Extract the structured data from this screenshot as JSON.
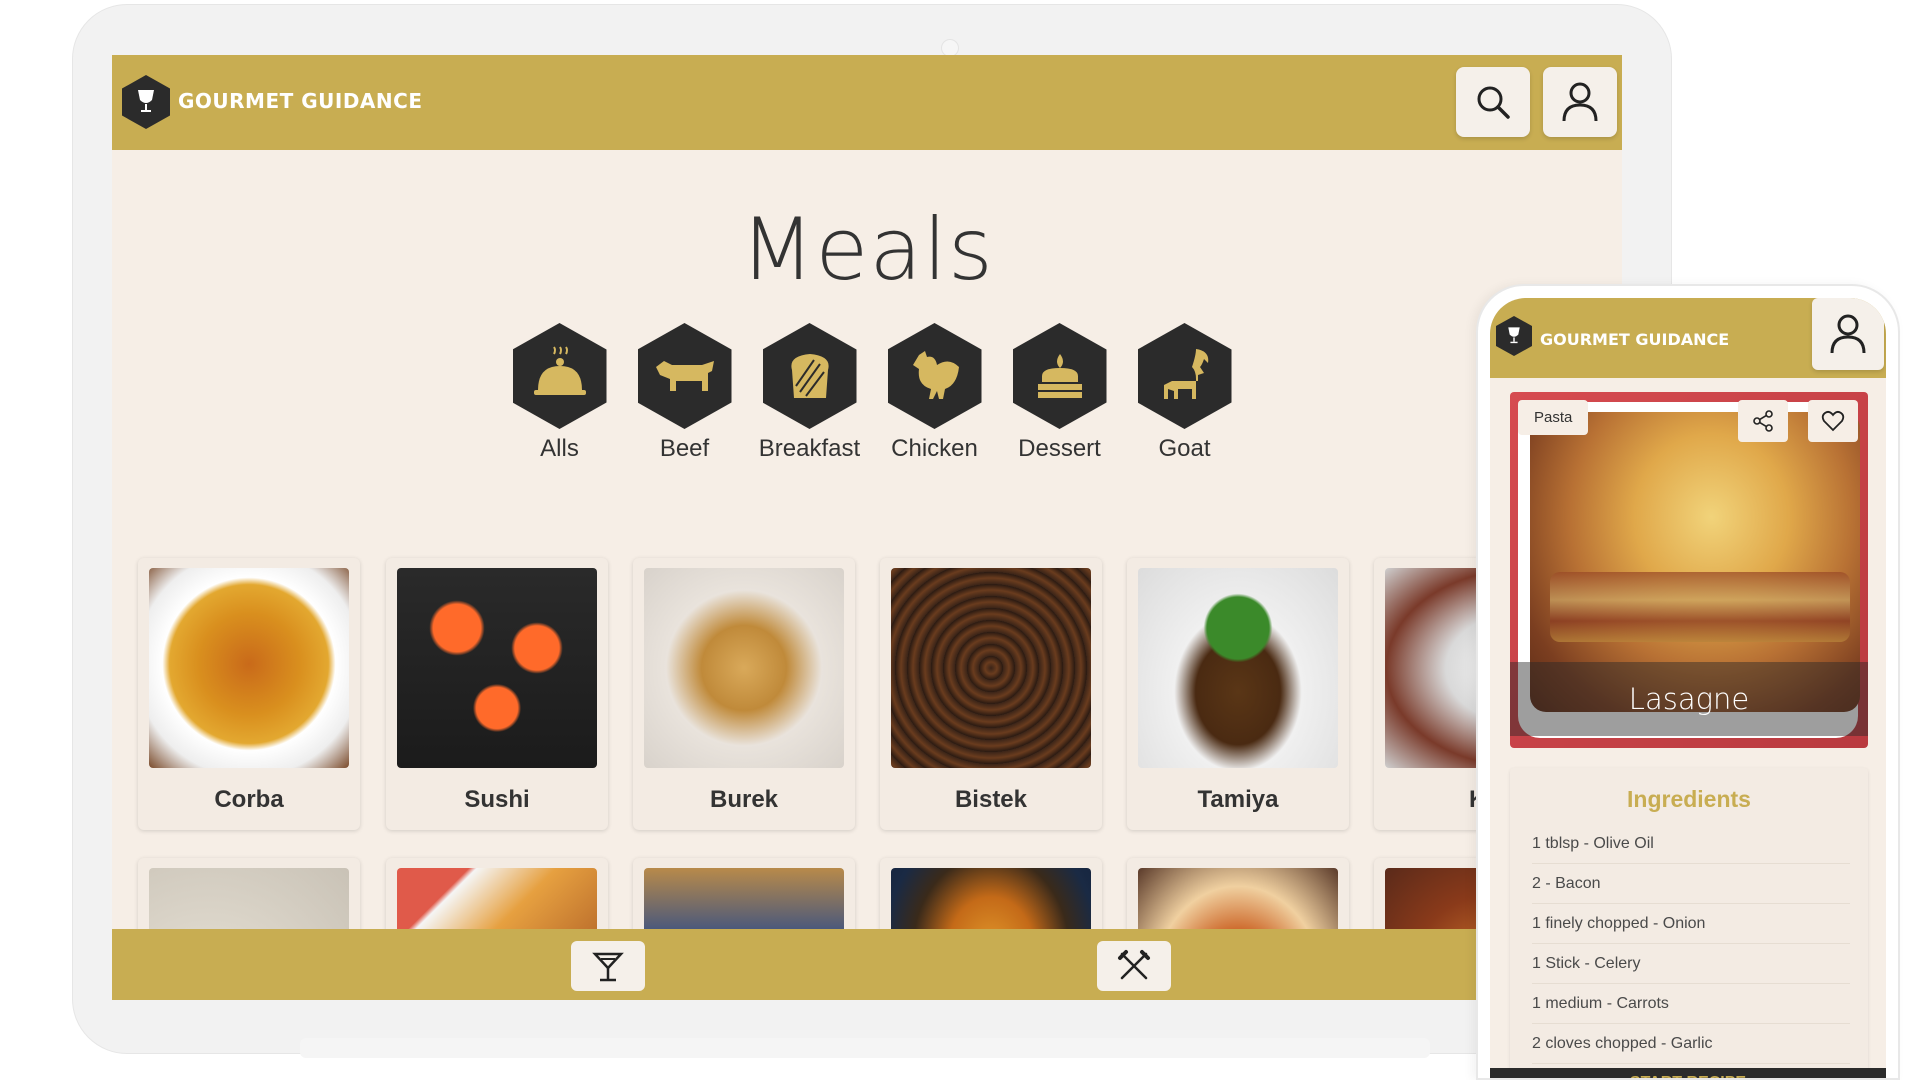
{
  "desktop": {
    "brand": "GOURMET GUIDANCE",
    "page_title": "Meals",
    "icons": {
      "search": "search-icon",
      "user": "user-icon",
      "logo": "wine-glass-icon"
    },
    "categories": [
      {
        "label": "Alls",
        "icon": "cloche-icon"
      },
      {
        "label": "Beef",
        "icon": "cow-icon"
      },
      {
        "label": "Breakfast",
        "icon": "bread-icon"
      },
      {
        "label": "Chicken",
        "icon": "chicken-icon"
      },
      {
        "label": "Dessert",
        "icon": "cake-icon"
      },
      {
        "label": "Goat",
        "icon": "goat-icon"
      }
    ],
    "meals_row1": [
      "Corba",
      "Sushi",
      "Burek",
      "Bistek",
      "Tamiya",
      "Ku"
    ],
    "footer": {
      "left_icon": "cocktail-icon",
      "right_icon": "utensils-icon"
    }
  },
  "mobile": {
    "brand": "GOURMET GUIDANCE",
    "recipe": {
      "tag": "Pasta",
      "name": "Lasagne"
    },
    "ingredients_title": "Ingredients",
    "ingredients": [
      "1 tblsp - Olive Oil",
      "2 - Bacon",
      "1 finely chopped - Onion",
      "1 Stick - Celery",
      "1 medium - Carrots",
      "2 cloves chopped - Garlic"
    ],
    "start_label": "START RECIPE"
  },
  "colors": {
    "accent": "#c8ad52",
    "dark": "#2b2b2b",
    "background": "#f6eee6"
  }
}
